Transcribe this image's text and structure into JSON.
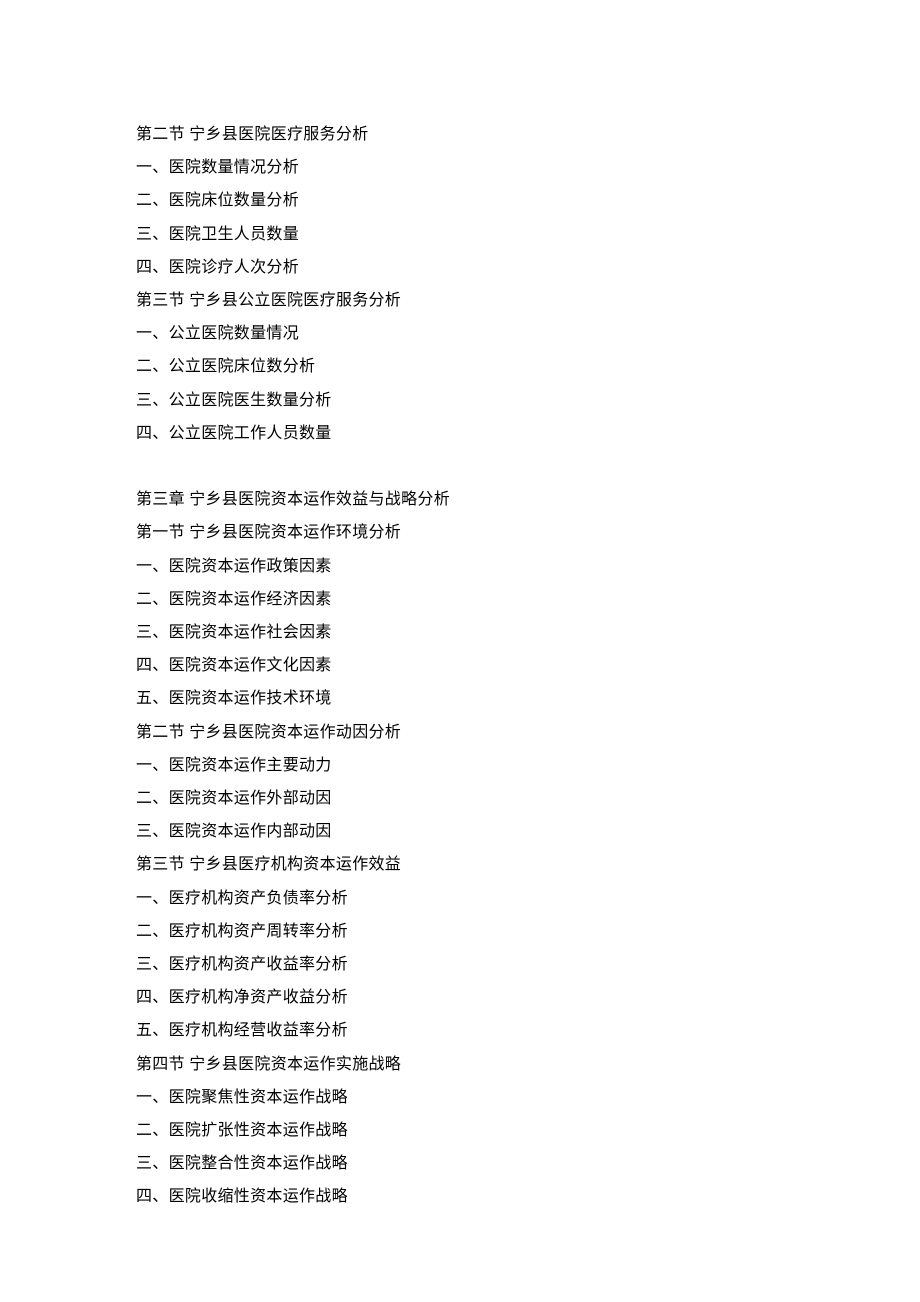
{
  "lines": [
    "第二节 宁乡县医院医疗服务分析",
    "一、医院数量情况分析",
    "二、医院床位数量分析",
    "三、医院卫生人员数量",
    "四、医院诊疗人次分析",
    "第三节 宁乡县公立医院医疗服务分析",
    "一、公立医院数量情况",
    "二、公立医院床位数分析",
    "三、公立医院医生数量分析",
    "四、公立医院工作人员数量",
    "",
    "第三章 宁乡县医院资本运作效益与战略分析",
    "第一节 宁乡县医院资本运作环境分析",
    "一、医院资本运作政策因素",
    "二、医院资本运作经济因素",
    "三、医院资本运作社会因素",
    "四、医院资本运作文化因素",
    "五、医院资本运作技术环境",
    "第二节 宁乡县医院资本运作动因分析",
    "一、医院资本运作主要动力",
    "二、医院资本运作外部动因",
    "三、医院资本运作内部动因",
    "第三节 宁乡县医疗机构资本运作效益",
    "一、医疗机构资产负债率分析",
    "二、医疗机构资产周转率分析",
    "三、医疗机构资产收益率分析",
    "四、医疗机构净资产收益分析",
    "五、医疗机构经营收益率分析",
    "第四节 宁乡县医院资本运作实施战略",
    "一、医院聚焦性资本运作战略",
    "二、医院扩张性资本运作战略",
    "三、医院整合性资本运作战略",
    "四、医院收缩性资本运作战略"
  ]
}
